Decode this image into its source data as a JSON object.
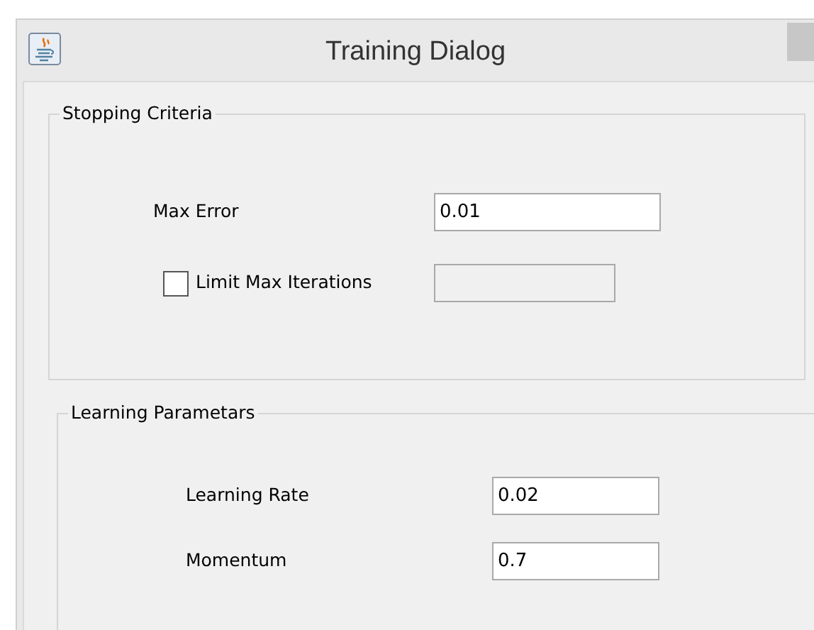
{
  "window": {
    "title": "Training Dialog"
  },
  "groups": [
    {
      "title": "Stopping Criteria",
      "rows": [
        {
          "kind": "field",
          "label": "Max Error",
          "value": "0.01",
          "disabled": false
        },
        {
          "kind": "checkbox",
          "label": "Limit Max Iterations",
          "checked": false,
          "disabled": true
        }
      ]
    },
    {
      "title": "Learning Parametars",
      "rows": [
        {
          "kind": "field",
          "label": "Learning Rate",
          "value": "0.02",
          "disabled": false
        },
        {
          "kind": "field",
          "label": "Momentum",
          "value": "0.7",
          "disabled": false
        }
      ]
    }
  ]
}
